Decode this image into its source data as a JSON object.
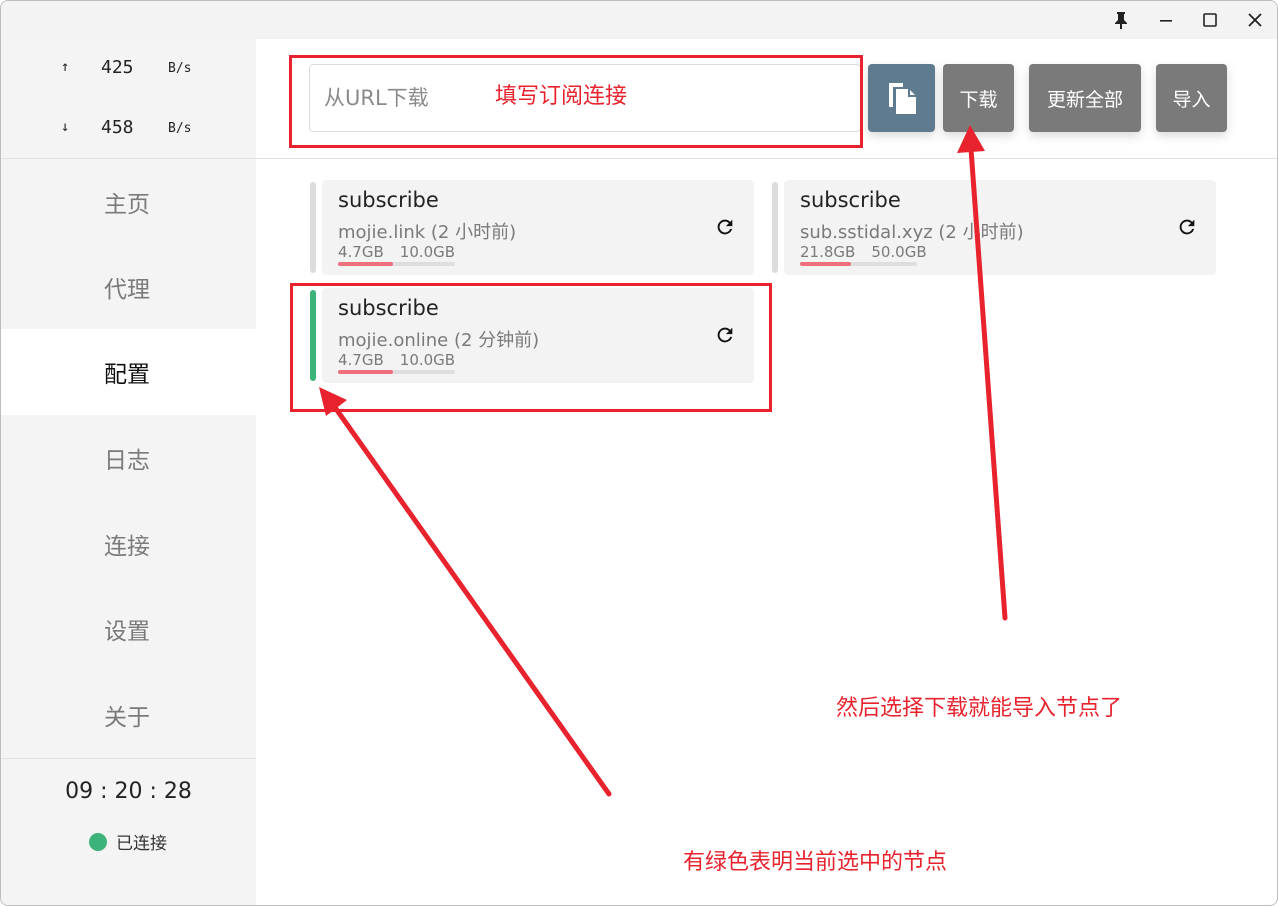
{
  "window_controls": {
    "pin_icon": "pin-icon",
    "minimize_icon": "minimize-icon",
    "maximize_icon": "maximize-icon",
    "close_icon": "close-icon"
  },
  "traffic": {
    "up": {
      "arrow": "↑",
      "value": "425",
      "unit": "B/s"
    },
    "down": {
      "arrow": "↓",
      "value": "458",
      "unit": "B/s"
    }
  },
  "nav": [
    {
      "label": "主页"
    },
    {
      "label": "代理"
    },
    {
      "label": "配置"
    },
    {
      "label": "日志"
    },
    {
      "label": "连接"
    },
    {
      "label": "设置"
    },
    {
      "label": "关于"
    }
  ],
  "clock": "09 : 20 : 28",
  "connection_status": {
    "label": "已连接",
    "color": "#3cb37a"
  },
  "toolbar": {
    "url_placeholder": "从URL下载",
    "paste_icon": "paste-icon",
    "download_label": "下载",
    "update_all_label": "更新全部",
    "import_label": "导入"
  },
  "profiles": [
    {
      "name": "subscribe",
      "source": "mojie.link (2 小时前)",
      "used": "4.7GB",
      "total": "10.0GB",
      "usage_fraction": 0.47,
      "selected": false
    },
    {
      "name": "subscribe",
      "source": "sub.sstidal.xyz (2 小时前)",
      "used": "21.8GB",
      "total": "50.0GB",
      "usage_fraction": 0.436,
      "selected": false
    },
    {
      "name": "subscribe",
      "source": "mojie.online (2 分钟前)",
      "used": "4.7GB",
      "total": "10.0GB",
      "usage_fraction": 0.47,
      "selected": true
    }
  ],
  "annotations": {
    "url_hint": "填写订阅连接",
    "download_hint": "然后选择下载就能导入节点了",
    "selected_hint": "有绿色表明当前选中的节点",
    "color": "#e8232e"
  },
  "colors": {
    "accent_green": "#3cb37a",
    "usage_red": "#ef6f7c",
    "paste_button": "#5f7b8f",
    "button_gray": "#7a7a7a"
  }
}
